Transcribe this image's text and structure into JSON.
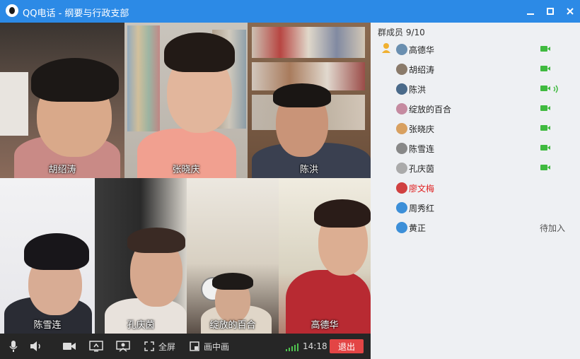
{
  "window": {
    "title": "QQ电话 - 纲要与行政支部"
  },
  "videos": [
    {
      "name": "胡绍涛"
    },
    {
      "name": "张晓庆"
    },
    {
      "name": "陈洪"
    },
    {
      "name": "陈雪连"
    },
    {
      "name": "孔庆茵"
    },
    {
      "name": "绽放的百合"
    },
    {
      "name": "高德华"
    }
  ],
  "controls": {
    "fullscreen_label": "全屏",
    "pip_label": "画中画",
    "time": "14:18",
    "exit_label": "退出"
  },
  "panel": {
    "header": "群成员 9/10",
    "members": [
      {
        "name": "高德华",
        "status": "video",
        "host": true,
        "avatar_color": "#6a8fb0"
      },
      {
        "name": "胡绍涛",
        "status": "video",
        "avatar_color": "#8a7a6a"
      },
      {
        "name": "陈洪",
        "status": "video-speaking",
        "avatar_color": "#4a6a8a"
      },
      {
        "name": "绽放的百合",
        "status": "video",
        "avatar_color": "#c58aa0"
      },
      {
        "name": "张晓庆",
        "status": "video",
        "avatar_color": "#d8a060"
      },
      {
        "name": "陈雪连",
        "status": "video",
        "avatar_color": "#888888"
      },
      {
        "name": "孔庆茵",
        "status": "video",
        "avatar_color": "#aaaaaa"
      },
      {
        "name": "廖文梅",
        "status": "none",
        "name_color": "#e02020",
        "avatar_color": "#d04040"
      },
      {
        "name": "周秀红",
        "status": "none",
        "avatar_color": "#3c8fd8"
      },
      {
        "name": "黄正",
        "status": "pending",
        "status_text": "待加入",
        "avatar_color": "#3c8fd8"
      }
    ]
  }
}
